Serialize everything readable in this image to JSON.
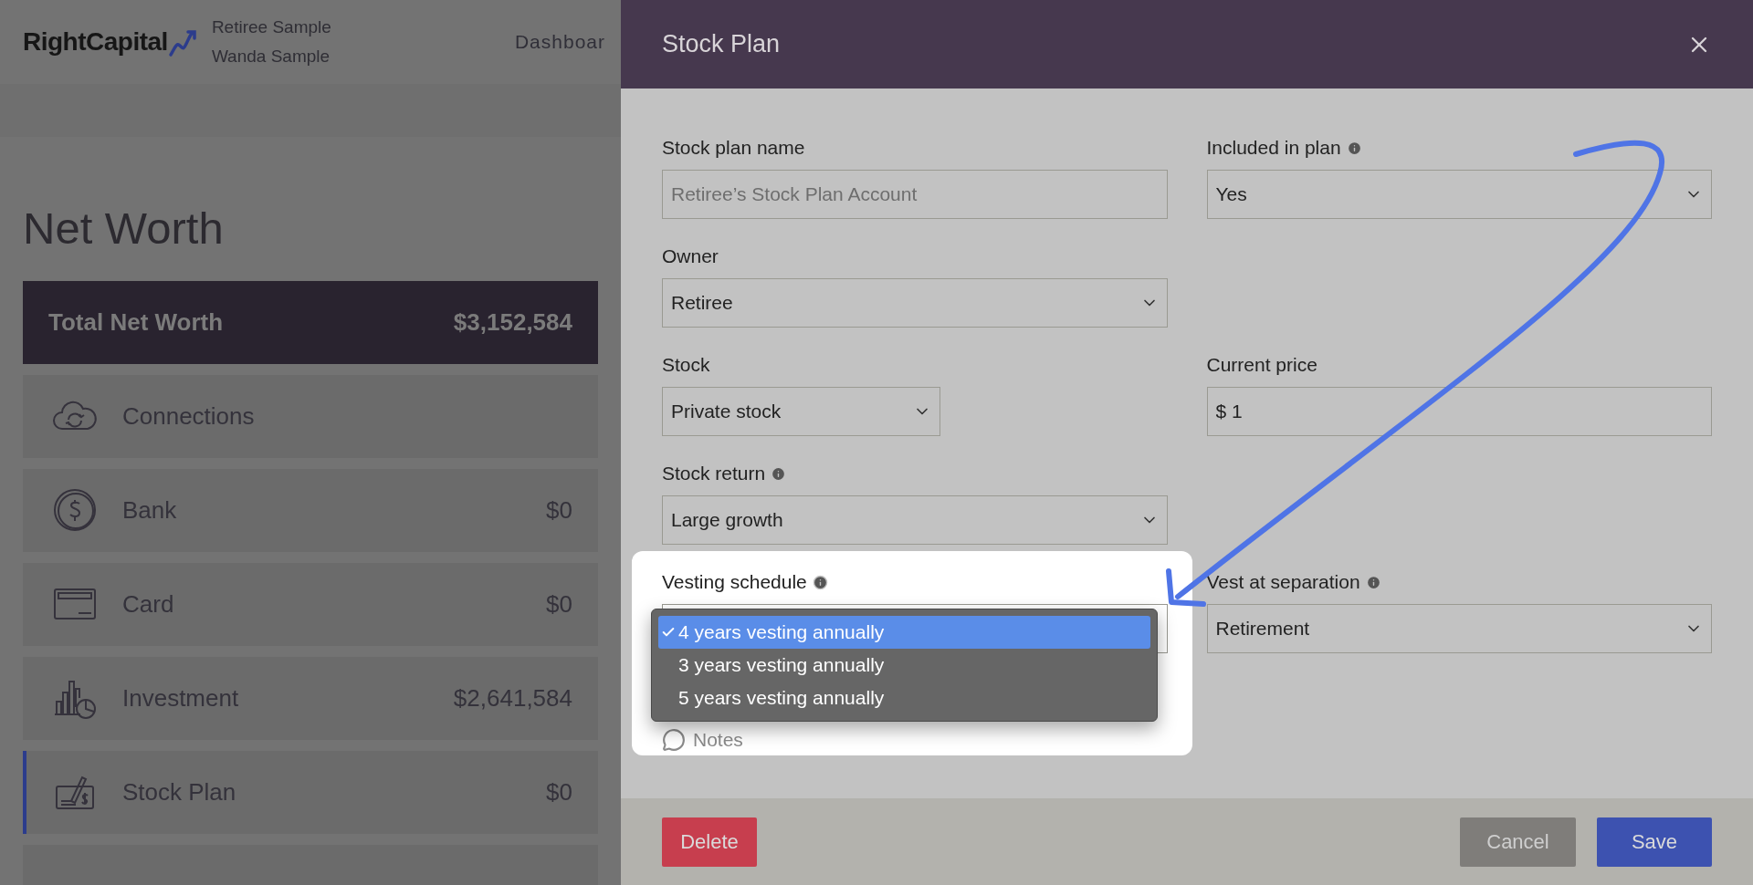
{
  "header": {
    "logo": "RightCapital",
    "clients": [
      "Retiree Sample",
      "Wanda Sample"
    ],
    "nav": "Dashboar"
  },
  "net_worth": {
    "title": "Net Worth",
    "total": {
      "label": "Total Net Worth",
      "value": "$3,152,584"
    },
    "items": [
      {
        "kind": "connections",
        "label": "Connections",
        "selected": false
      },
      {
        "kind": "bank",
        "label": "Bank",
        "value": "$0",
        "selected": false
      },
      {
        "kind": "card",
        "label": "Card",
        "value": "$0",
        "selected": false
      },
      {
        "kind": "investment",
        "label": "Investment",
        "value": "$2,641,584",
        "selected": false
      },
      {
        "kind": "stock_plan",
        "label": "Stock Plan",
        "value": "$0",
        "selected": true
      }
    ]
  },
  "dialog": {
    "title": "Stock Plan",
    "rows": [
      {
        "left": {
          "label": "Stock plan name",
          "kind": "text",
          "placeholder": "Retiree’s Stock Plan Account"
        },
        "right": {
          "label": "Included in plan",
          "info": true,
          "kind": "select",
          "value": "Yes"
        }
      },
      {
        "left": {
          "label": "Owner",
          "kind": "select",
          "value": "Retiree"
        }
      },
      {
        "left": {
          "label": "Stock",
          "kind": "select",
          "value": "Private stock",
          "compact": true
        },
        "right": {
          "label": "Current price",
          "kind": "text",
          "value": "$ 1"
        }
      },
      {
        "left": {
          "label": "Stock return",
          "info": true,
          "kind": "select",
          "value": "Large growth"
        }
      },
      {
        "left": {
          "label": "Vesting schedule",
          "info": true,
          "kind": "select",
          "expanded": true,
          "highlighted": true,
          "options": [
            {
              "label": "4 years vesting annually",
              "selected": true
            },
            {
              "label": "3 years vesting annually",
              "selected": false
            },
            {
              "label": "5 years vesting annually",
              "selected": false
            }
          ]
        },
        "right": {
          "label": "Vest at separation",
          "info": true,
          "kind": "select",
          "value": "Retirement"
        }
      }
    ],
    "notes": "Notes",
    "buttons": {
      "delete": "Delete",
      "cancel": "Cancel",
      "save": "Save"
    }
  }
}
